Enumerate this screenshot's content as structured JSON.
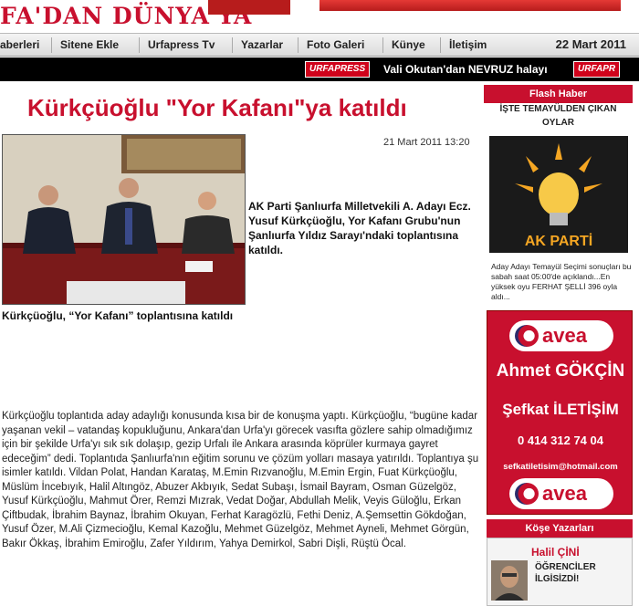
{
  "header": {
    "logo_text": "FA'DAN DÜNYA'YA"
  },
  "nav": {
    "items": [
      "aberleri",
      "Sitene Ekle",
      "Urfapress Tv",
      "Yazarlar",
      "Foto Galeri",
      "Künye",
      "İletişim"
    ],
    "date": "22 Mart 2011"
  },
  "ticker": {
    "logo_left": "URFAPRESS",
    "headline": "Vali Okutan'dan NEVRUZ halayı",
    "logo_right": "URFAPR"
  },
  "article": {
    "title": "Kürkçüoğlu \"Yor Kafanı\"ya katıldı",
    "date": "21 Mart 2011 13:20",
    "lead": "AK Parti Şanlıurfa Milletvekili A. Adayı Ecz. Yusuf Kürkçüoğlu, Yor Kafanı Grubu'nun Şanlıurfa Yıldız Sarayı'ndaki toplantısına katıldı.",
    "caption": "Kürkçüoğlu, “Yor Kafanı” toplantısına katıldı",
    "body": "Kürkçüoğlu toplantıda aday adaylığı konusunda kısa bir de konuşma yaptı. Kürkçüoğlu, “bugüne kadar yaşanan vekil – vatandaş kopukluğunu, Ankara'dan Urfa'yı görecek vasıfta gözlere sahip olmadığımız için bir şekilde Urfa'yı sık sık dolaşıp, gezip Urfalı ile Ankara arasında köprüler kurmaya gayret edeceğim” dedi. Toplantıda Şanlıurfa'nın eğitim sorunu ve çözüm yolları masaya yatırıldı. Toplantıya şu isimler katıldı. Vildan Polat, Handan Karataş, M.Emin Rızvanoğlu, M.Emin Ergin, Fuat Kürkçüoğlu, Müslüm İncebıyık, Halil Altıngöz, Abuzer Akbıyık, Sedat Subaşı, İsmail Bayram, Osman Güzelgöz, Yusuf Kürkçüoğlu, Mahmut Örer, Remzi Mızrak, Vedat Doğar, Abdullah Melik, Veyis Güloğlu, Erkan Çiftbudak, İbrahim Baynaz, İbrahim Okuyan, Ferhat Karagözlü, Fethi Deniz, A.Şemsettin Gökdoğan, Yusuf Özer, M.Ali Çizmecioğlu, Kemal Kazoğlu, Mehmet Güzelgöz, Mehmet Ayneli, Mehmet Görgün, Bakır Ökkaş, İbrahim Emiroğlu, Zafer Yıldırım, Yahya Demirkol, Sabri Dişli, Rüştü Öcal."
  },
  "sidebar": {
    "flash_header": "Flash Haber",
    "flash_sub": "İŞTE TEMAYÜLDEN ÇIKAN OYLAR",
    "akp_label": "AK PARTİ",
    "flash_text": "Aday Adayı Temayül Seçimi sonuçları bu sabah saat 05:00'de açıklandı...En yüksek oyu FERHAT ŞELLİ 396 oyla aldı...",
    "ad": {
      "brand": "avea",
      "name": "Ahmet GÖKÇİN",
      "company": "Şefkat İLETİŞİM",
      "phone": "0 414 312 74 04",
      "email": "sefkatiletisim@hotmail.com"
    },
    "columnists_header": "Köşe Yazarları",
    "author_name": "Halil ÇİNİ",
    "author_title_1": "ÖĞRENCİLER",
    "author_title_2": "İLGİSİZDİ!"
  },
  "colors": {
    "accent": "#c8102e",
    "ticker_bg": "#000000"
  }
}
